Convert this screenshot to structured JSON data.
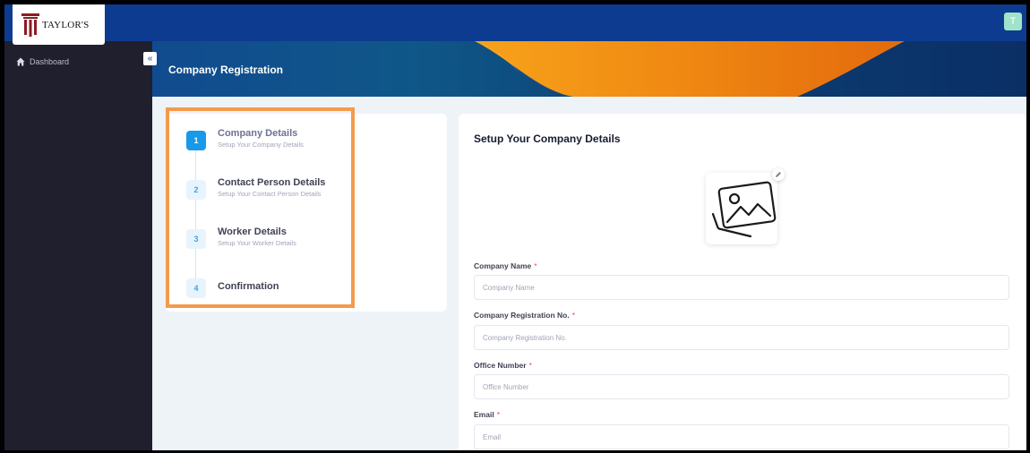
{
  "header": {
    "logo_text": "TAYLOR'S",
    "avatar_letter": "T",
    "colors": {
      "topbar": "#0d3b8f",
      "avatar": "#9fe4c8"
    }
  },
  "sidebar": {
    "collapse_icon": "«",
    "items": [
      {
        "label": "Dashboard",
        "icon": "home-icon"
      }
    ]
  },
  "banner": {
    "title": "Company Registration"
  },
  "steps": [
    {
      "number": "1",
      "title": "Company Details",
      "subtitle": "Setup Your Company Details",
      "active": true
    },
    {
      "number": "2",
      "title": "Contact Person Details",
      "subtitle": "Setup Your Contact Person Details",
      "active": false
    },
    {
      "number": "3",
      "title": "Worker Details",
      "subtitle": "Setup Your Worker Details",
      "active": false
    },
    {
      "number": "4",
      "title": "Confirmation",
      "subtitle": "",
      "active": false
    }
  ],
  "form": {
    "title": "Setup Your Company Details",
    "image_icon": "image-placeholder-icon",
    "edit_icon": "pencil-icon",
    "required_mark": "*",
    "fields": [
      {
        "label": "Company Name",
        "placeholder": "Company Name",
        "value": ""
      },
      {
        "label": "Company Registration No.",
        "placeholder": "Company Registration No.",
        "value": ""
      },
      {
        "label": "Office Number",
        "placeholder": "Office Number",
        "value": ""
      },
      {
        "label": "Email",
        "placeholder": "Email",
        "value": ""
      }
    ]
  },
  "colors": {
    "step_active": "#1899ea",
    "highlight": "#f39a4c",
    "required": "#f1416c"
  }
}
